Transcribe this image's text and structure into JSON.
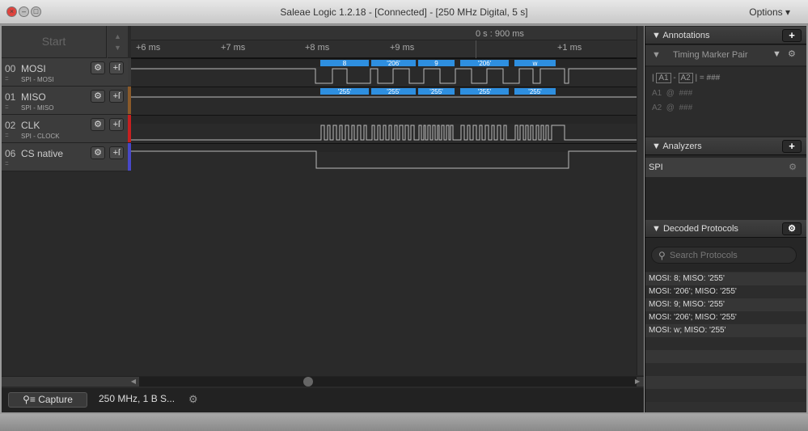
{
  "window": {
    "title": "Saleae Logic 1.2.18 - [Connected] - [250 MHz Digital, 5 s]",
    "options": "Options ▾"
  },
  "controls": {
    "start": "Start"
  },
  "ruler": {
    "marker": "0 s : 900 ms",
    "ticks": [
      "+6 ms",
      "+7 ms",
      "+8 ms",
      "+9 ms",
      "+1 ms"
    ]
  },
  "channels": [
    {
      "num": "00",
      "name": "MOSI",
      "sub": "SPI - MOSI",
      "color": "#3a3a3a"
    },
    {
      "num": "01",
      "name": "MISO",
      "sub": "SPI - MISO",
      "color": "#8a5a2a"
    },
    {
      "num": "02",
      "name": "CLK",
      "sub": "SPI - CLOCK",
      "color": "#c62020"
    },
    {
      "num": "06",
      "name": "CS native",
      "sub": "",
      "color": "#4848c8"
    }
  ],
  "decoded_frames": {
    "mosi": [
      "8",
      "'206'",
      "9",
      "'206'",
      "w"
    ],
    "miso": [
      "'255'",
      "'255'",
      "'255'",
      "'255'",
      "'255'"
    ]
  },
  "frame_color": "#2e8fe0",
  "bottom": {
    "capture": "Capture",
    "rate": "250 MHz, 1 B S..."
  },
  "annotations": {
    "title": "Annotations",
    "marker_type": "Timing Marker Pair",
    "formula_a1": "A1",
    "formula_a2": "A2",
    "formula_rest": "| = ###",
    "a1_line": "A1  @  ###",
    "a2_line": "A2  @  ###"
  },
  "analyzers": {
    "title": "Analyzers",
    "items": [
      "SPI"
    ]
  },
  "decoded": {
    "title": "Decoded Protocols",
    "search_placeholder": "Search Protocols",
    "rows": [
      "MOSI: 8;  MISO: '255'",
      "MOSI: '206';  MISO: '255'",
      "MOSI: 9;  MISO: '255'",
      "MOSI: '206';  MISO: '255'",
      "MOSI: w;  MISO: '255'"
    ]
  }
}
